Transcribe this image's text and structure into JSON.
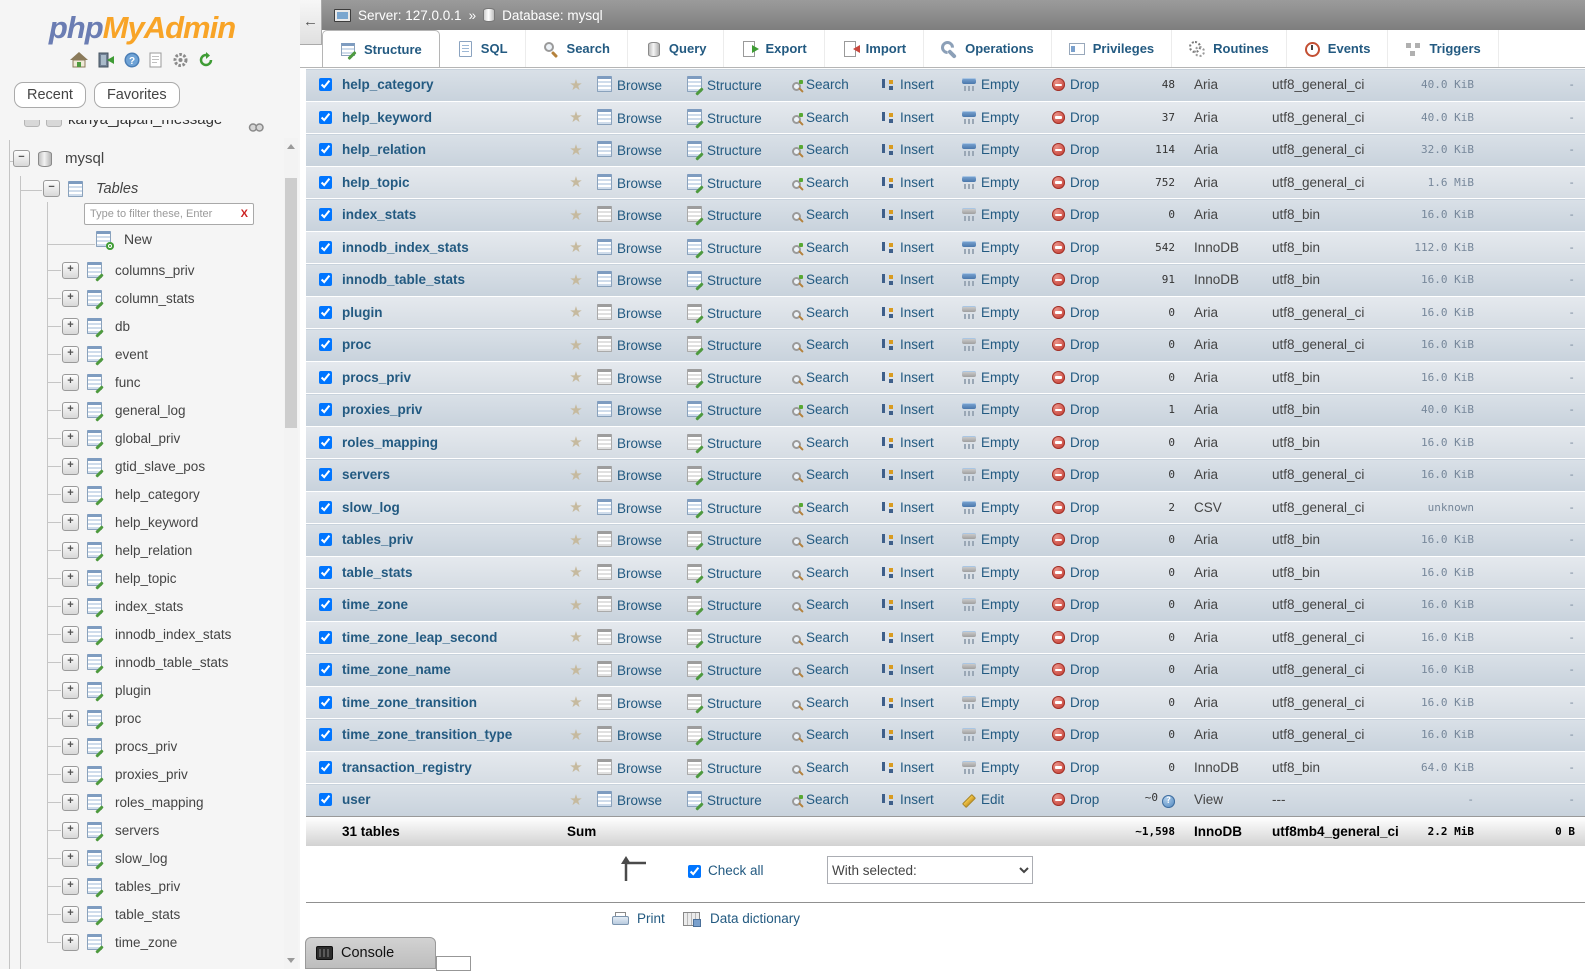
{
  "logo": {
    "part1": "php",
    "part2": "MyAdmin"
  },
  "sidebar": {
    "buttons": [
      {
        "label": "Recent"
      },
      {
        "label": "Favorites"
      }
    ],
    "clipped_item": "kanya_japan_message",
    "db_name": "mysql",
    "tables_label": "Tables",
    "filter_placeholder": "Type to filter these, Enter",
    "filter_clear": "X",
    "new_label": "New",
    "tables": [
      "columns_priv",
      "column_stats",
      "db",
      "event",
      "func",
      "general_log",
      "global_priv",
      "gtid_slave_pos",
      "help_category",
      "help_keyword",
      "help_relation",
      "help_topic",
      "index_stats",
      "innodb_index_stats",
      "innodb_table_stats",
      "plugin",
      "proc",
      "procs_priv",
      "proxies_priv",
      "roles_mapping",
      "servers",
      "slow_log",
      "tables_priv",
      "table_stats",
      "time_zone"
    ]
  },
  "topbar": {
    "collapse_arrow": "←",
    "server_label": "Server: 127.0.0.1",
    "separator": "»",
    "database_label": "Database: mysql"
  },
  "tabs": [
    {
      "label": "Structure",
      "icon": "structure-tab-icon",
      "css": "t-struct",
      "active": true
    },
    {
      "label": "SQL",
      "icon": "sql-tab-icon",
      "css": "t-sql",
      "active": false
    },
    {
      "label": "Search",
      "icon": "search-tab-icon",
      "css": "t-search",
      "active": false
    },
    {
      "label": "Query",
      "icon": "query-tab-icon",
      "css": "t-query",
      "active": false
    },
    {
      "label": "Export",
      "icon": "export-tab-icon",
      "css": "t-export",
      "active": false
    },
    {
      "label": "Import",
      "icon": "import-tab-icon",
      "css": "t-import",
      "active": false
    },
    {
      "label": "Operations",
      "icon": "operations-tab-icon",
      "css": "t-ops",
      "active": false
    },
    {
      "label": "Privileges",
      "icon": "privileges-tab-icon",
      "css": "t-priv",
      "active": false
    },
    {
      "label": "Routines",
      "icon": "routines-tab-icon",
      "css": "t-routines",
      "active": false
    },
    {
      "label": "Events",
      "icon": "events-tab-icon",
      "css": "t-events",
      "active": false
    },
    {
      "label": "Triggers",
      "icon": "triggers-tab-icon",
      "css": "t-trig",
      "active": false
    }
  ],
  "table": {
    "actions": {
      "browse": "Browse",
      "structure": "Structure",
      "search": "Search",
      "insert": "Insert",
      "empty": "Empty",
      "drop": "Drop",
      "edit": "Edit"
    },
    "rows": [
      {
        "name": "help_category",
        "rows": "48",
        "engine": "Aria",
        "collation": "utf8_general_ci",
        "size": "40.0 KiB",
        "overhead": "-",
        "has_rows": true,
        "is_view": false
      },
      {
        "name": "help_keyword",
        "rows": "37",
        "engine": "Aria",
        "collation": "utf8_general_ci",
        "size": "40.0 KiB",
        "overhead": "-",
        "has_rows": true,
        "is_view": false
      },
      {
        "name": "help_relation",
        "rows": "114",
        "engine": "Aria",
        "collation": "utf8_general_ci",
        "size": "32.0 KiB",
        "overhead": "-",
        "has_rows": true,
        "is_view": false
      },
      {
        "name": "help_topic",
        "rows": "752",
        "engine": "Aria",
        "collation": "utf8_general_ci",
        "size": "1.6 MiB",
        "overhead": "-",
        "has_rows": true,
        "is_view": false
      },
      {
        "name": "index_stats",
        "rows": "0",
        "engine": "Aria",
        "collation": "utf8_bin",
        "size": "16.0 KiB",
        "overhead": "-",
        "has_rows": false,
        "is_view": false
      },
      {
        "name": "innodb_index_stats",
        "rows": "542",
        "engine": "InnoDB",
        "collation": "utf8_bin",
        "size": "112.0 KiB",
        "overhead": "-",
        "has_rows": true,
        "is_view": false
      },
      {
        "name": "innodb_table_stats",
        "rows": "91",
        "engine": "InnoDB",
        "collation": "utf8_bin",
        "size": "16.0 KiB",
        "overhead": "-",
        "has_rows": true,
        "is_view": false
      },
      {
        "name": "plugin",
        "rows": "0",
        "engine": "Aria",
        "collation": "utf8_general_ci",
        "size": "16.0 KiB",
        "overhead": "-",
        "has_rows": false,
        "is_view": false
      },
      {
        "name": "proc",
        "rows": "0",
        "engine": "Aria",
        "collation": "utf8_general_ci",
        "size": "16.0 KiB",
        "overhead": "-",
        "has_rows": false,
        "is_view": false
      },
      {
        "name": "procs_priv",
        "rows": "0",
        "engine": "Aria",
        "collation": "utf8_bin",
        "size": "16.0 KiB",
        "overhead": "-",
        "has_rows": false,
        "is_view": false
      },
      {
        "name": "proxies_priv",
        "rows": "1",
        "engine": "Aria",
        "collation": "utf8_bin",
        "size": "40.0 KiB",
        "overhead": "-",
        "has_rows": true,
        "is_view": false
      },
      {
        "name": "roles_mapping",
        "rows": "0",
        "engine": "Aria",
        "collation": "utf8_bin",
        "size": "16.0 KiB",
        "overhead": "-",
        "has_rows": false,
        "is_view": false
      },
      {
        "name": "servers",
        "rows": "0",
        "engine": "Aria",
        "collation": "utf8_general_ci",
        "size": "16.0 KiB",
        "overhead": "-",
        "has_rows": false,
        "is_view": false
      },
      {
        "name": "slow_log",
        "rows": "2",
        "engine": "CSV",
        "collation": "utf8_general_ci",
        "size": "unknown",
        "overhead": "-",
        "has_rows": true,
        "is_view": false
      },
      {
        "name": "tables_priv",
        "rows": "0",
        "engine": "Aria",
        "collation": "utf8_bin",
        "size": "16.0 KiB",
        "overhead": "-",
        "has_rows": false,
        "is_view": false
      },
      {
        "name": "table_stats",
        "rows": "0",
        "engine": "Aria",
        "collation": "utf8_bin",
        "size": "16.0 KiB",
        "overhead": "-",
        "has_rows": false,
        "is_view": false
      },
      {
        "name": "time_zone",
        "rows": "0",
        "engine": "Aria",
        "collation": "utf8_general_ci",
        "size": "16.0 KiB",
        "overhead": "-",
        "has_rows": false,
        "is_view": false
      },
      {
        "name": "time_zone_leap_second",
        "rows": "0",
        "engine": "Aria",
        "collation": "utf8_general_ci",
        "size": "16.0 KiB",
        "overhead": "-",
        "has_rows": false,
        "is_view": false
      },
      {
        "name": "time_zone_name",
        "rows": "0",
        "engine": "Aria",
        "collation": "utf8_general_ci",
        "size": "16.0 KiB",
        "overhead": "-",
        "has_rows": false,
        "is_view": false
      },
      {
        "name": "time_zone_transition",
        "rows": "0",
        "engine": "Aria",
        "collation": "utf8_general_ci",
        "size": "16.0 KiB",
        "overhead": "-",
        "has_rows": false,
        "is_view": false
      },
      {
        "name": "time_zone_transition_type",
        "rows": "0",
        "engine": "Aria",
        "collation": "utf8_general_ci",
        "size": "16.0 KiB",
        "overhead": "-",
        "has_rows": false,
        "is_view": false
      },
      {
        "name": "transaction_registry",
        "rows": "0",
        "engine": "InnoDB",
        "collation": "utf8_bin",
        "size": "64.0 KiB",
        "overhead": "-",
        "has_rows": false,
        "is_view": false
      },
      {
        "name": "user",
        "rows": "~0",
        "engine": "View",
        "collation": "---",
        "size": "-",
        "overhead": "-",
        "has_rows": true,
        "is_view": true
      }
    ],
    "sum": {
      "count_label": "31 tables",
      "sum_label": "Sum",
      "rows": "~1,598",
      "engine": "InnoDB",
      "collation": "utf8mb4_general_ci",
      "size": "2.2 MiB",
      "overhead": "0 B"
    }
  },
  "footer": {
    "check_all": "Check all",
    "with_selected": "With selected:",
    "print_label": "Print",
    "data_dictionary_label": "Data dictionary"
  },
  "console": {
    "label": "Console"
  },
  "icons": {
    "plus": "+",
    "minus": "−",
    "star": "★"
  },
  "colors": {
    "link": "#235a81",
    "logo_php": "#6b7db3",
    "logo_myadmin": "#f8a427",
    "drop_red": "#c9473d"
  }
}
